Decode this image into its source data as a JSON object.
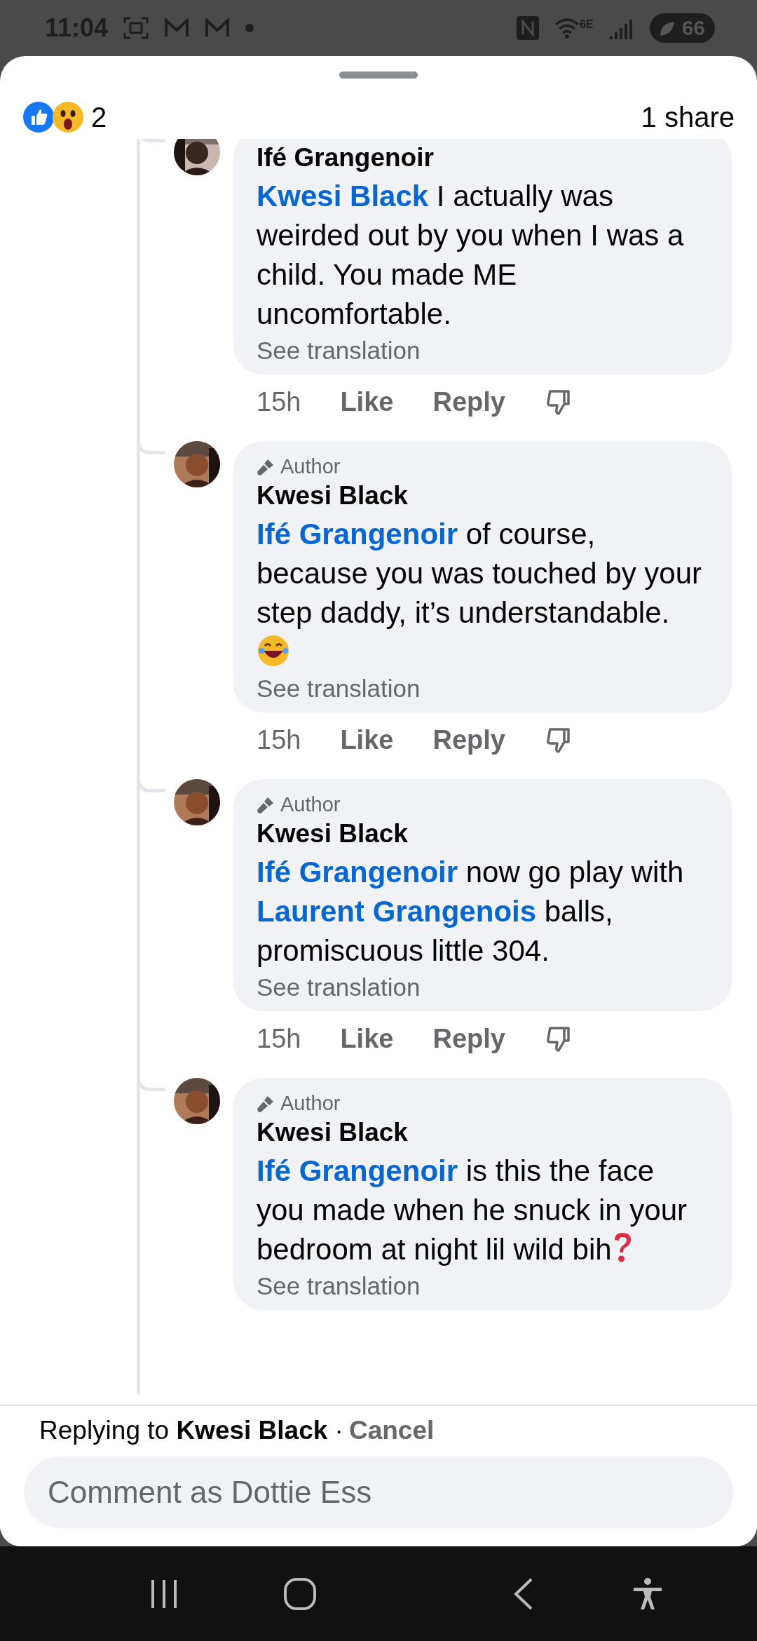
{
  "status_bar": {
    "time": "11:04",
    "network": "6E",
    "battery": "66"
  },
  "reactions": {
    "count": "2",
    "shares": "1 share"
  },
  "comments": [
    {
      "name": "Ifé Grangenoir",
      "body": [
        {
          "kind": "mention",
          "text": "Kwesi Black"
        },
        {
          "kind": "text",
          "text": " I actually was weirded out by you when I was a child. You made ME uncomfortable."
        }
      ],
      "translation": "See translation",
      "time": "15h",
      "like": "Like",
      "reply": "Reply"
    },
    {
      "badge": "Author",
      "name": "Kwesi Black",
      "body": [
        {
          "kind": "mention",
          "text": "Ifé Grangenoir"
        },
        {
          "kind": "text",
          "text": " of course, because you was touched by your step daddy, it’s understandable. "
        },
        {
          "kind": "laughing-emoji"
        }
      ],
      "translation": "See translation",
      "time": "15h",
      "like": "Like",
      "reply": "Reply"
    },
    {
      "badge": "Author",
      "name": "Kwesi Black",
      "body": [
        {
          "kind": "mention",
          "text": "Ifé Grangenoir"
        },
        {
          "kind": "text",
          "text": " now go play with "
        },
        {
          "kind": "mention",
          "text": "Laurent Grangenois"
        },
        {
          "kind": "text",
          "text": "  balls, promiscuous little 304."
        }
      ],
      "translation": "See translation",
      "time": "15h",
      "like": "Like",
      "reply": "Reply"
    },
    {
      "badge": "Author",
      "name": "Kwesi Black",
      "body": [
        {
          "kind": "mention",
          "text": "Ifé Grangenoir"
        },
        {
          "kind": "text",
          "text": " is this the face you made when he snuck in your bedroom at night lil wild bih"
        },
        {
          "kind": "question-emoji"
        }
      ],
      "translation": "See translation"
    }
  ],
  "reply_bar": {
    "label": "Replying to **Kwesi Black** ·",
    "cancel": "Cancel",
    "placeholder": "Comment as Dottie Ess"
  }
}
